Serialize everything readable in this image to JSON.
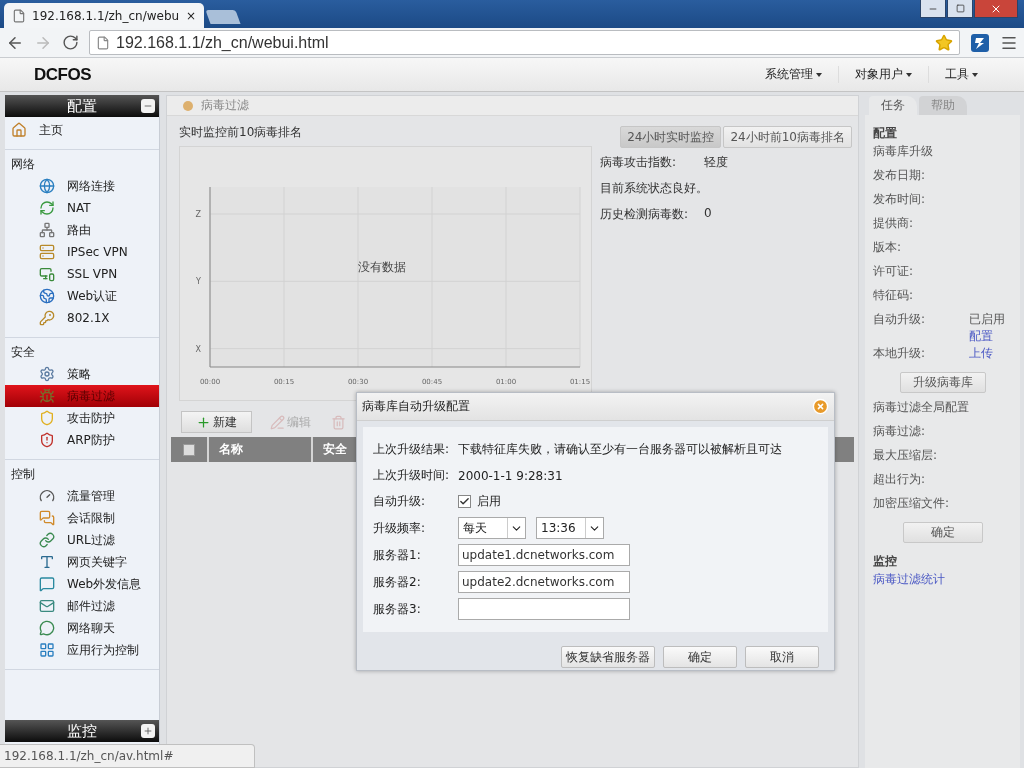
{
  "browser": {
    "tab_title": "192.168.1.1/zh_cn/webu",
    "tab_close": "×",
    "address": "192.168.1.1/zh_cn/webui.html",
    "status_url": "192.168.1.1/zh_cn/av.html#"
  },
  "app": {
    "logo": "DCFOS",
    "menus": [
      "系统管理",
      "对象用户",
      "工具"
    ]
  },
  "sidebar": {
    "top_panel": {
      "title": "配置",
      "expanded": true
    },
    "groups": [
      {
        "items": [
          {
            "label": "主页",
            "selected": false
          }
        ]
      },
      {
        "heading": "网络",
        "items": [
          {
            "label": "网络连接",
            "selected": false
          },
          {
            "label": "NAT",
            "selected": false
          },
          {
            "label": "路由",
            "selected": false
          },
          {
            "label": "IPSec VPN",
            "selected": false
          },
          {
            "label": "SSL VPN",
            "selected": false
          },
          {
            "label": "Web认证",
            "selected": false
          },
          {
            "label": "802.1X",
            "selected": false
          }
        ]
      },
      {
        "heading": "安全",
        "items": [
          {
            "label": "策略",
            "selected": false
          },
          {
            "label": "病毒过滤",
            "selected": true
          },
          {
            "label": "攻击防护",
            "selected": false
          },
          {
            "label": "ARP防护",
            "selected": false
          }
        ]
      },
      {
        "heading": "控制",
        "items": [
          {
            "label": "流量管理",
            "selected": false
          },
          {
            "label": "会话限制",
            "selected": false
          },
          {
            "label": "URL过滤",
            "selected": false
          },
          {
            "label": "网页关键字",
            "selected": false
          },
          {
            "label": "Web外发信息",
            "selected": false
          },
          {
            "label": "邮件过滤",
            "selected": false
          },
          {
            "label": "网络聊天",
            "selected": false
          },
          {
            "label": "应用行为控制",
            "selected": false
          }
        ]
      }
    ],
    "bottom_panel": {
      "title": "监控",
      "expanded": false
    }
  },
  "main": {
    "breadcrumb": "病毒过滤",
    "section_title": "实时监控前10病毒排名",
    "view_tabs": [
      {
        "label": "24小时实时监控",
        "selected": true
      },
      {
        "label": "24小时前10病毒排名",
        "selected": false
      }
    ],
    "chart": {
      "yticks": [
        "Z",
        "Y",
        "X"
      ],
      "xticks": [
        "00:00",
        "00:15",
        "00:30",
        "00:45",
        "01:00",
        "01:15"
      ],
      "message": "没有数据"
    },
    "stats": [
      {
        "label": "病毒攻击指数:",
        "value": "轻度"
      },
      {
        "label": "目前系统状态良好。"
      },
      {
        "label": "历史检测病毒数:",
        "value": "0"
      }
    ],
    "toolbar": [
      {
        "kind": "new",
        "label": "新建",
        "disabled": false
      },
      {
        "kind": "edit",
        "label": "编辑",
        "disabled": true
      },
      {
        "kind": "delete",
        "disabled": true
      }
    ],
    "table": {
      "select_all_checked": false,
      "columns": [
        "名称",
        "安全"
      ]
    }
  },
  "dialog": {
    "title": "病毒库自动升级配置",
    "last_result": {
      "label": "上次升级结果:",
      "value": "下载特征库失败，请确认至少有一台服务器可以被解析且可达"
    },
    "last_time": {
      "label": "上次升级时间:",
      "value": "2000-1-1 9:28:31"
    },
    "auto_upgrade": {
      "label": "自动升级:",
      "option": "启用",
      "checked": true
    },
    "frequency": {
      "label": "升级频率:",
      "day": "每天",
      "time": "13:36"
    },
    "servers": [
      {
        "label": "服务器1:",
        "value": "update1.dcnetworks.com"
      },
      {
        "label": "服务器2:",
        "value": "update2.dcnetworks.com"
      },
      {
        "label": "服务器3:"
      }
    ],
    "buttons": [
      "恢复缺省服务器",
      "确定",
      "取消"
    ]
  },
  "task_panel": {
    "tabs": [
      {
        "label": "任务",
        "selected": true
      },
      {
        "label": "帮助",
        "selected": false
      }
    ],
    "entries": [
      {
        "kind": "heading",
        "label": "配置"
      },
      {
        "kind": "field",
        "label": "病毒库升级"
      },
      {
        "kind": "field",
        "label": "发布日期:"
      },
      {
        "kind": "field",
        "label": "发布时间:"
      },
      {
        "kind": "field",
        "label": "提供商:"
      },
      {
        "kind": "field",
        "label": "版本:"
      },
      {
        "kind": "field",
        "label": "许可证:"
      },
      {
        "kind": "field",
        "label": "特征码:"
      },
      {
        "kind": "field",
        "label": "自动升级:",
        "value": "已启用",
        "link": "配置"
      },
      {
        "kind": "field",
        "label": "本地升级:",
        "link": "上传"
      },
      {
        "kind": "button",
        "label": "升级病毒库"
      },
      {
        "kind": "field",
        "label": "病毒过滤全局配置"
      },
      {
        "kind": "field",
        "label": "病毒过滤:"
      },
      {
        "kind": "field",
        "label": "最大压缩层:"
      },
      {
        "kind": "field",
        "label": "超出行为:"
      },
      {
        "kind": "field",
        "label": "加密压缩文件:"
      },
      {
        "kind": "button",
        "label": "确定"
      },
      {
        "kind": "heading",
        "label": "监控"
      },
      {
        "kind": "link",
        "label": "病毒过滤统计"
      }
    ]
  }
}
